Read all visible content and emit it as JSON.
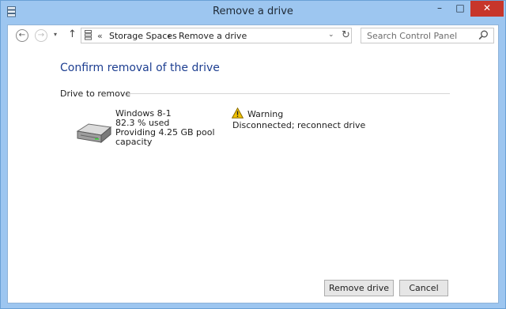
{
  "window": {
    "title": "Remove a drive",
    "minimize_glyph": "–",
    "maximize_glyph": "□",
    "close_glyph": "✕"
  },
  "nav": {
    "back_glyph": "←",
    "forward_glyph": "→",
    "recent_glyph": "▾",
    "up_glyph": "↑"
  },
  "address": {
    "separator": "«",
    "crumbs": [
      "Storage Spaces",
      "Remove a drive"
    ],
    "crumb_separator": "▸",
    "dropdown_glyph": "⌄",
    "refresh_glyph": "↻"
  },
  "search": {
    "placeholder": "Search Control Panel"
  },
  "page": {
    "heading": "Confirm removal of the drive",
    "section_label": "Drive to remove"
  },
  "drive": {
    "name": "Windows 8-1",
    "usage": "82.3 % used",
    "providing_line1": "Providing 4.25 GB pool",
    "providing_line2": "capacity",
    "status_label": "Warning",
    "status_text": "Disconnected; reconnect drive"
  },
  "buttons": {
    "remove": "Remove drive",
    "cancel": "Cancel"
  },
  "icons": {
    "app": "storage-spaces-icon",
    "drive": "hard-drive-icon",
    "warning": "warning-icon",
    "search": "search-icon"
  },
  "colors": {
    "title_bar": "#9dc6f0",
    "close_button": "#c7362b",
    "heading": "#1e3f91",
    "warning": "#f2c200"
  }
}
